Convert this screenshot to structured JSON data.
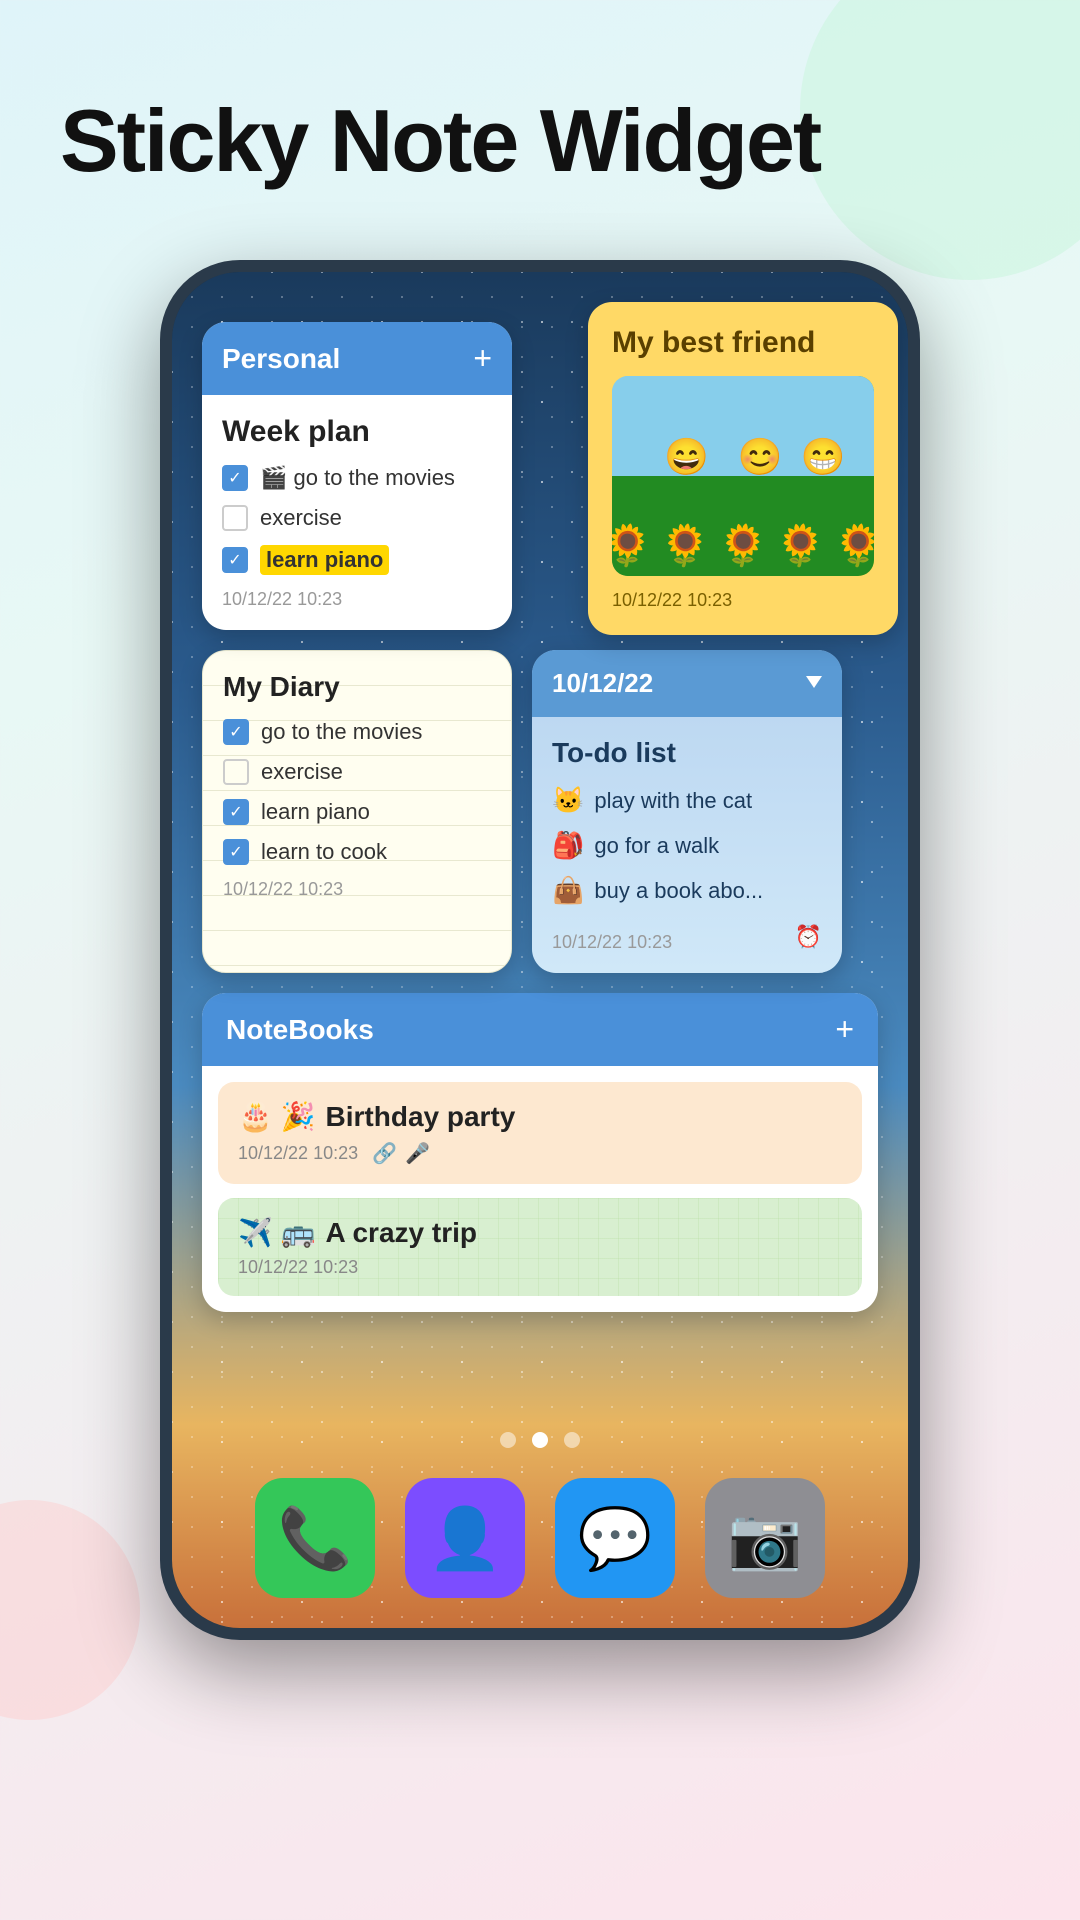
{
  "page": {
    "title": "Sticky Note Widget",
    "background": {
      "topRight": "decorative circle",
      "bottomLeft": "decorative circle"
    }
  },
  "widgets": {
    "personal": {
      "header": "Personal",
      "plus": "+",
      "title": "Week plan",
      "items": [
        {
          "checked": true,
          "text": "🎬 go to the movies"
        },
        {
          "checked": false,
          "text": "exercise"
        },
        {
          "checked": true,
          "text": "learn piano",
          "highlight": true
        }
      ],
      "timestamp": "10/12/22 10:23"
    },
    "bestFriend": {
      "title": "My best friend",
      "timestamp": "10/12/22 10:23"
    },
    "myDiary": {
      "title": "My Diary",
      "items": [
        {
          "checked": true,
          "text": "go to the movies"
        },
        {
          "checked": false,
          "text": "exercise"
        },
        {
          "checked": true,
          "text": "learn piano"
        },
        {
          "checked": true,
          "text": "learn to cook"
        }
      ],
      "timestamp": "10/12/22 10:23"
    },
    "todoList": {
      "headerDate": "10/12/22",
      "title": "To-do list",
      "items": [
        {
          "emoji": "🐱",
          "text": "play with the cat"
        },
        {
          "emoji": "🎒",
          "text": "go for a walk"
        },
        {
          "emoji": "👜",
          "text": "buy a book abo..."
        }
      ],
      "timestamp": "10/12/22 10:23",
      "alarmIcon": "⏰"
    },
    "notebooks": {
      "header": "NoteBooks",
      "plus": "+",
      "items": [
        {
          "emoji": "🎂 🎉",
          "name": "Birthday party",
          "timestamp": "10/12/22 10:23",
          "hasLink": true,
          "hasMic": true,
          "color": "peach"
        },
        {
          "emoji": "✈️ 🚌",
          "name": "A crazy trip",
          "timestamp": "10/12/22 10:23",
          "color": "green"
        }
      ]
    }
  },
  "pageDots": {
    "count": 3,
    "active": 1
  },
  "dock": {
    "icons": [
      {
        "name": "phone",
        "color": "green",
        "emoji": "📞"
      },
      {
        "name": "contacts",
        "color": "purple",
        "emoji": "👤"
      },
      {
        "name": "messages",
        "color": "blue",
        "emoji": "💬"
      },
      {
        "name": "camera",
        "color": "gray",
        "emoji": "📷"
      }
    ]
  }
}
